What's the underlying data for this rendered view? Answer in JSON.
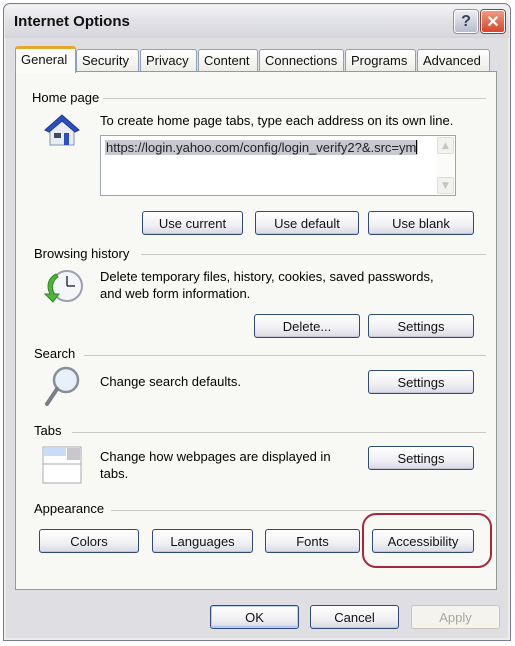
{
  "window": {
    "title": "Internet Options",
    "help_button": "?",
    "close_button": "✕"
  },
  "tabs": [
    {
      "label": "General",
      "active": true
    },
    {
      "label": "Security",
      "active": false
    },
    {
      "label": "Privacy",
      "active": false
    },
    {
      "label": "Content",
      "active": false
    },
    {
      "label": "Connections",
      "active": false
    },
    {
      "label": "Programs",
      "active": false
    },
    {
      "label": "Advanced",
      "active": false
    }
  ],
  "home_page": {
    "label": "Home page",
    "icon": "house-icon",
    "description": "To create home page tabs, type each address on its own line.",
    "url_value": "https://login.yahoo.com/config/login_verify2?&.src=ym",
    "buttons": {
      "use_current": "Use current",
      "use_default": "Use default",
      "use_blank": "Use blank"
    }
  },
  "browsing_history": {
    "label": "Browsing history",
    "icon": "history-clock-icon",
    "description_line1": "Delete temporary files, history, cookies, saved passwords,",
    "description_line2": "and web form information.",
    "buttons": {
      "delete": "Delete...",
      "settings": "Settings"
    }
  },
  "search": {
    "label": "Search",
    "icon": "magnifier-icon",
    "description": "Change search defaults.",
    "buttons": {
      "settings": "Settings"
    }
  },
  "tabs_section": {
    "label": "Tabs",
    "icon": "tabs-window-icon",
    "description_line1": "Change how webpages are displayed in",
    "description_line2": "tabs.",
    "buttons": {
      "settings": "Settings"
    }
  },
  "appearance": {
    "label": "Appearance",
    "buttons": {
      "colors": "Colors",
      "languages": "Languages",
      "fonts": "Fonts",
      "accessibility": "Accessibility"
    },
    "highlighted": "accessibility"
  },
  "footer": {
    "ok": "OK",
    "cancel": "Cancel",
    "apply": "Apply",
    "apply_enabled": false
  },
  "colors": {
    "highlight_ring": "#a4283a",
    "active_tab_accent": "#e8a82a",
    "button_border": "#2f4c78"
  }
}
